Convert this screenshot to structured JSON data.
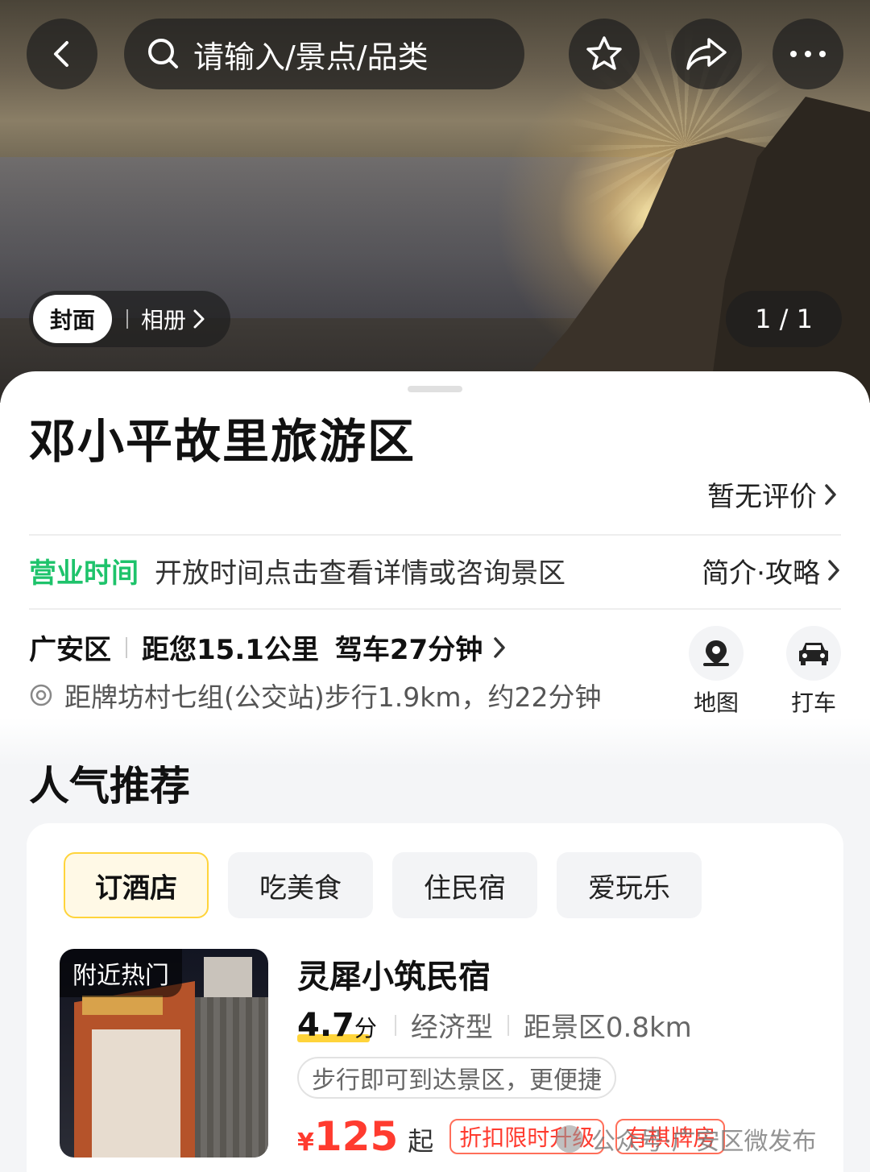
{
  "header": {
    "search_placeholder": "请输入/景点/品类",
    "icons": [
      "back-icon",
      "search-icon",
      "star-icon",
      "share-icon",
      "more-icon"
    ]
  },
  "gallery": {
    "cover_label": "封面",
    "album_label": "相册",
    "counter": "1 / 1"
  },
  "place": {
    "title": "邓小平故里旅游区",
    "reviews_link": "暂无评价",
    "hours_label": "营业时间",
    "hours_text": "开放时间点击查看详情或咨询景区",
    "intro_link": "简介·攻略",
    "district": "广安区",
    "distance": "距您15.1公里",
    "drive": "驾车27分钟",
    "address": "距牌坊村七组(公交站)步行1.9km，约22分钟",
    "map_label": "地图",
    "taxi_label": "打车"
  },
  "recommend": {
    "title": "人气推荐",
    "tabs": [
      "订酒店",
      "吃美食",
      "住民宿",
      "爱玩乐"
    ],
    "active_tab": 0,
    "hotel": {
      "badge": "附近热门",
      "name": "灵犀小筑民宿",
      "score": "4.7",
      "score_unit": "分",
      "category": "经济型",
      "distance": "距景区0.8km",
      "tag": "步行即可到达景区，更便捷",
      "currency": "¥",
      "price": "125",
      "price_suffix": "起",
      "promo1": "折扣限时升级",
      "promo2": "有棋牌房"
    }
  },
  "watermark": "公众号·广安区微发布",
  "colors": {
    "accent_green": "#1ec36b",
    "price_red": "#ff3b2f",
    "tab_active_border": "#ffd43b",
    "score_highlight": "#ffd43b"
  }
}
